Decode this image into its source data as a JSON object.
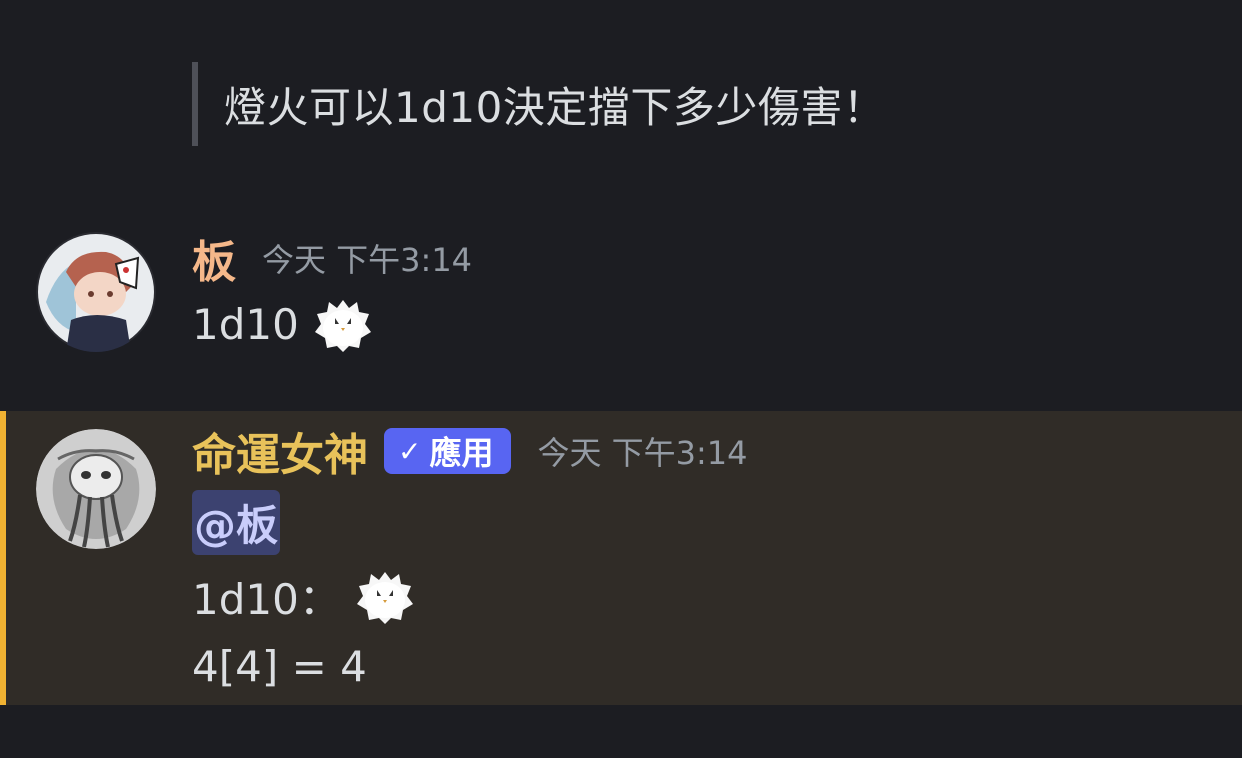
{
  "quote": {
    "text": "燈火可以1d10決定擋下多少傷害！"
  },
  "messages": [
    {
      "username": "板",
      "timestamp": "今天 下午3:14",
      "text": "1d10",
      "emoji": "fluffy-white-bird-emoji"
    },
    {
      "username": "命運女神",
      "app_tag": "應用",
      "timestamp": "今天 下午3:14",
      "mention": "@板",
      "roll_text": "1d10：",
      "emoji": "fluffy-white-bird-emoji",
      "result": "4[4] = 4"
    }
  ],
  "colors": {
    "background": "#1c1d22",
    "highlight_background": "#302c27",
    "highlight_bar": "#f0b232",
    "username_1": "#f5b88a",
    "username_2": "#e8c25a",
    "app_tag": "#5865f2",
    "mention_bg": "#3c4270"
  }
}
